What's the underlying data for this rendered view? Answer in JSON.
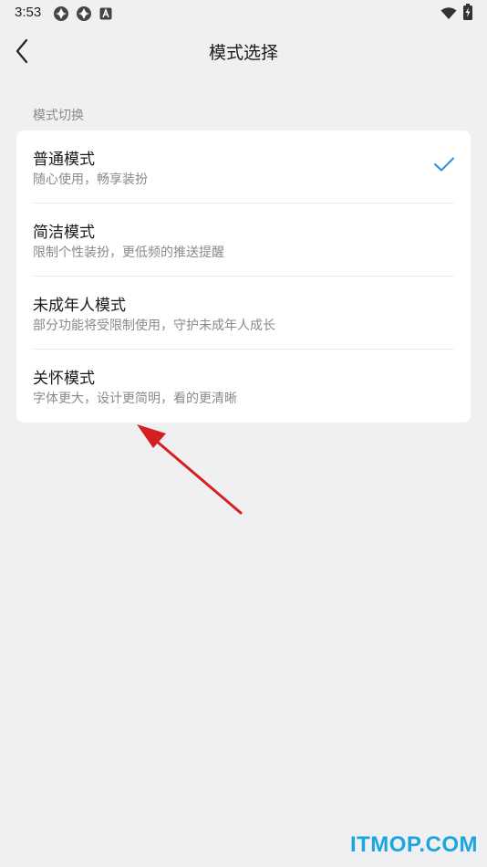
{
  "status_bar": {
    "time": "3:53",
    "left_icons": [
      "app-notification-icon",
      "app-notification-icon",
      "a-icon"
    ],
    "right_icons": [
      "wifi-icon",
      "battery-charging-icon"
    ]
  },
  "header": {
    "title": "模式选择",
    "back_icon": "chevron-left-icon"
  },
  "section": {
    "label": "模式切换"
  },
  "modes": [
    {
      "title": "普通模式",
      "subtitle": "随心使用，畅享装扮",
      "selected": true
    },
    {
      "title": "简洁模式",
      "subtitle": "限制个性装扮，更低频的推送提醒",
      "selected": false
    },
    {
      "title": "未成年人模式",
      "subtitle": "部分功能将受限制使用，守护未成年人成长",
      "selected": false
    },
    {
      "title": "关怀模式",
      "subtitle": "字体更大，设计更简明，看的更清晰",
      "selected": false
    }
  ],
  "watermark": "ITMOP.COM",
  "colors": {
    "accent": "#2b8fe0",
    "background": "#f0f0f2",
    "card": "#ffffff",
    "annotation_arrow": "#d42020",
    "watermark": "#1aa6e0"
  }
}
